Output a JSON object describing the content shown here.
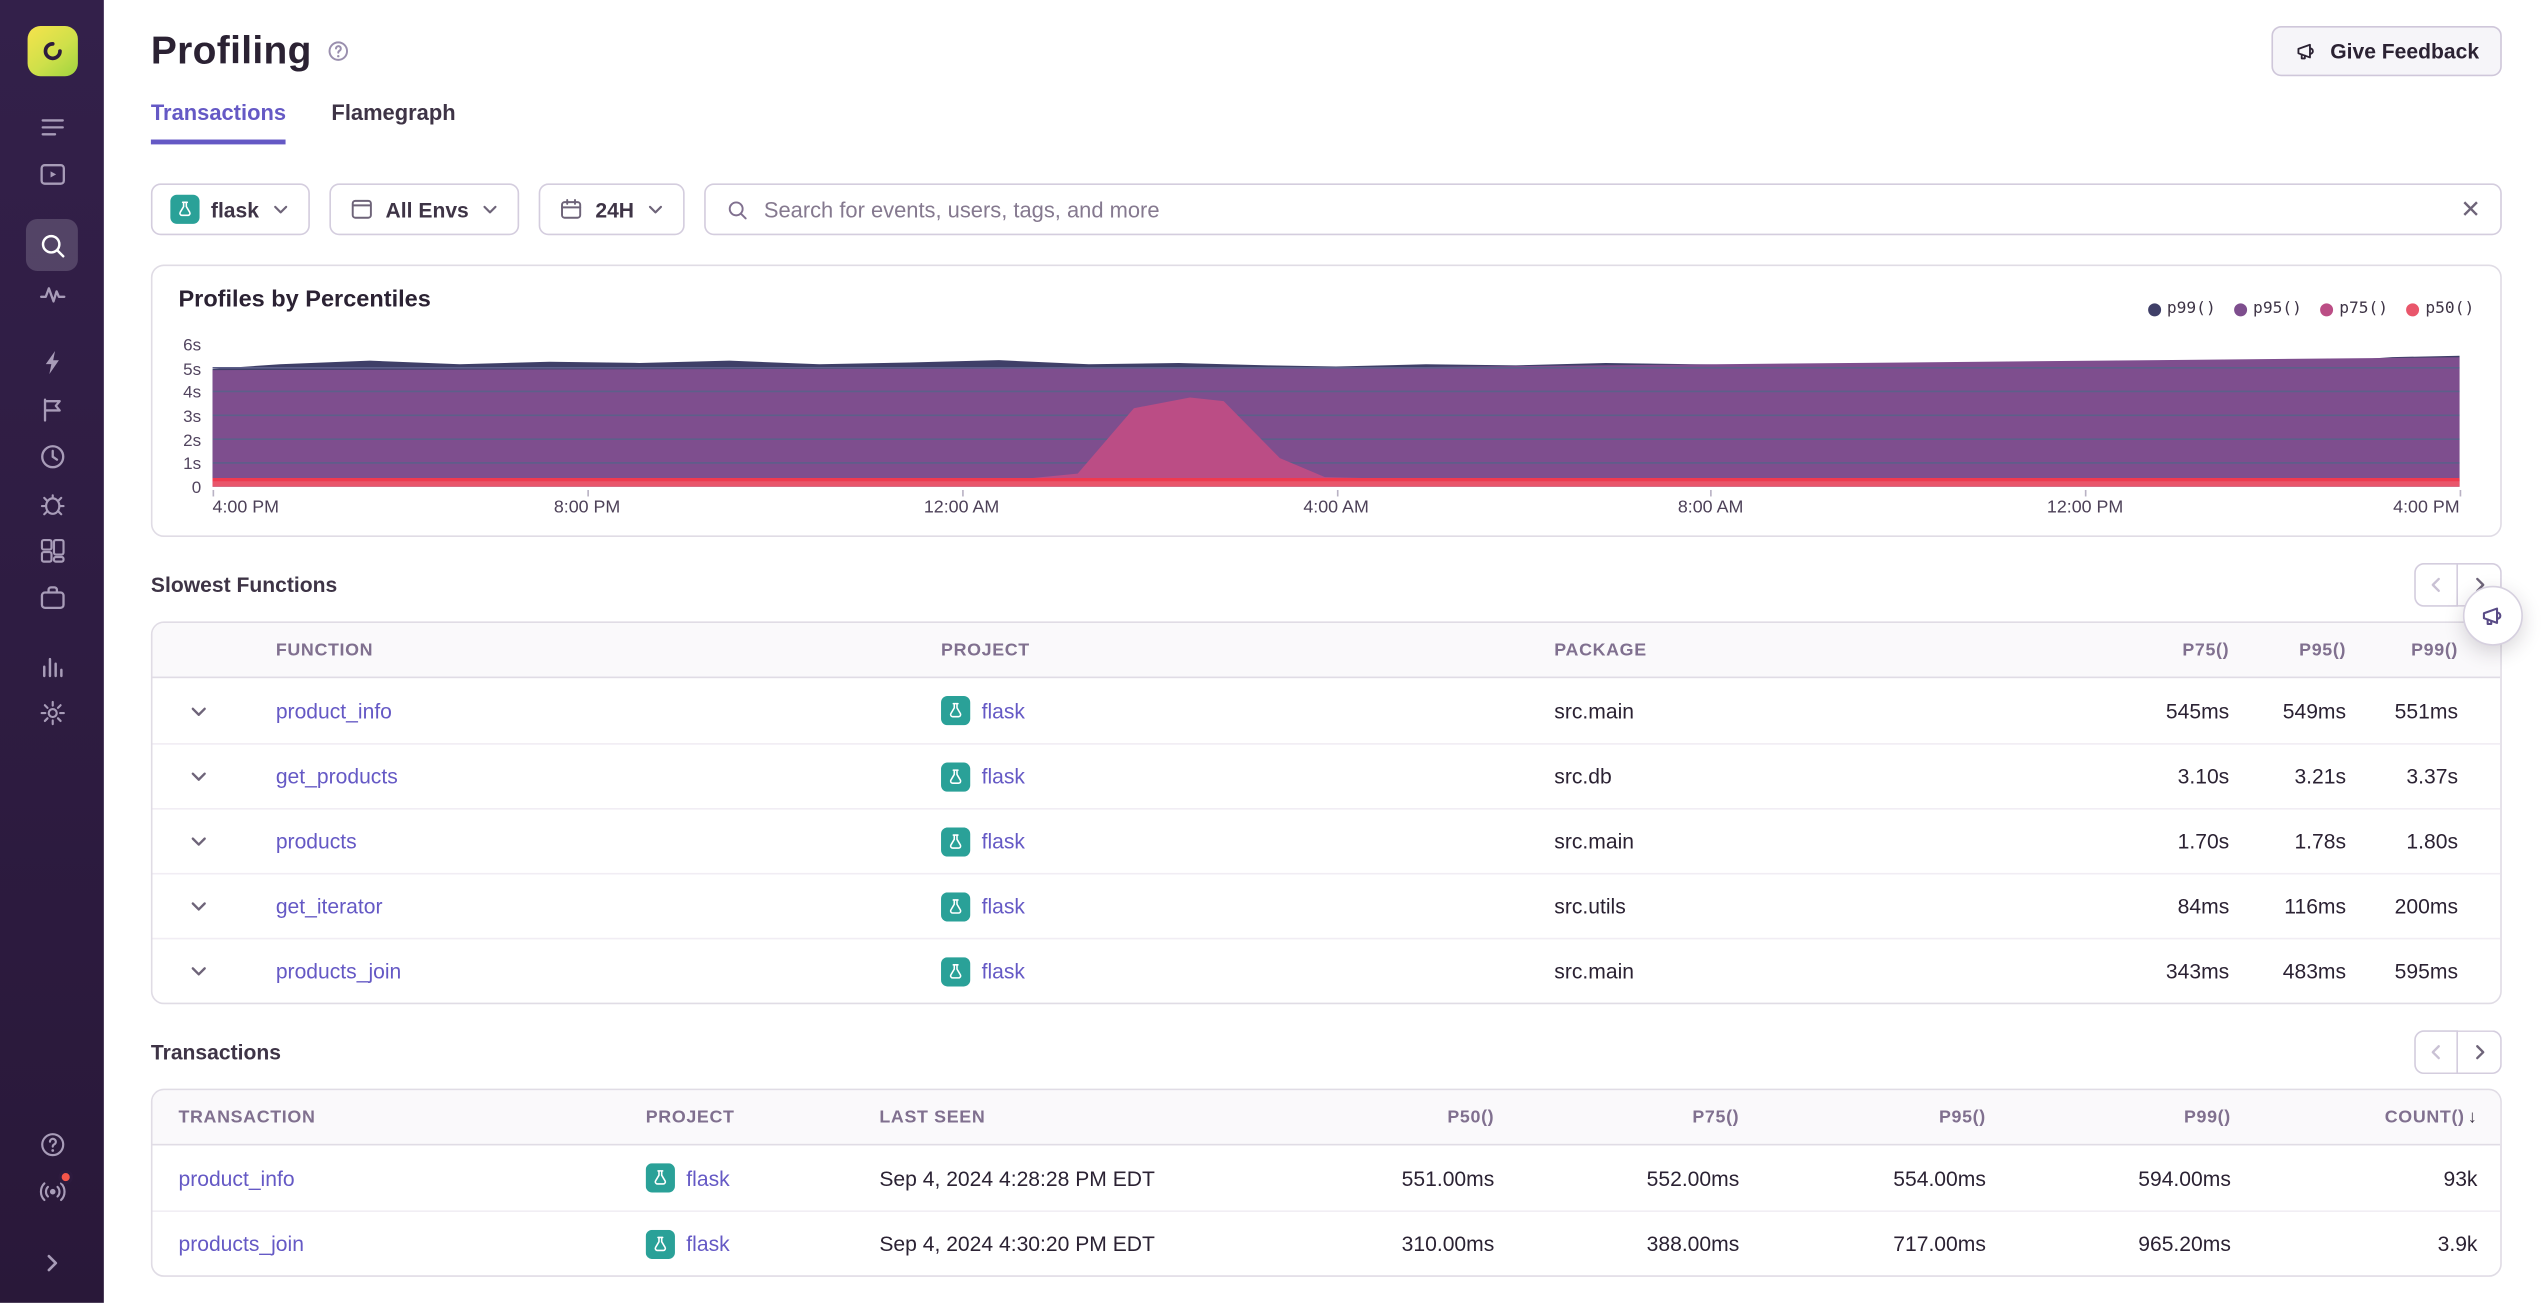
{
  "sidebar": {
    "icons": [
      "sentry-logo",
      "list",
      "play-window",
      "search",
      "pulse",
      "lightning",
      "flag",
      "clock",
      "bug",
      "grid",
      "briefcase",
      "bar-chart",
      "gear"
    ],
    "active_icon": "search",
    "bottom_icons": [
      "help",
      "broadcast",
      "expand"
    ],
    "notification_dot_color": "#f5554a"
  },
  "header": {
    "title": "Profiling",
    "feedback_label": "Give Feedback"
  },
  "tabs": [
    {
      "label": "Transactions",
      "active": true
    },
    {
      "label": "Flamegraph",
      "active": false
    }
  ],
  "filters": {
    "project": "flask",
    "environment": "All Envs",
    "date_range": "24H",
    "search_placeholder": "Search for events, users, tags, and more"
  },
  "chart_data": {
    "type": "area",
    "title": "Profiles by Percentiles",
    "x_ticks": [
      "4:00 PM",
      "8:00 PM",
      "12:00 AM",
      "4:00 AM",
      "8:00 AM",
      "12:00 PM",
      "4:00 PM"
    ],
    "y_ticks": [
      "6s",
      "5s",
      "4s",
      "3s",
      "2s",
      "1s",
      "0"
    ],
    "ylim_seconds": [
      0,
      6
    ],
    "grid": true,
    "gridline_color": "#5d5f8a",
    "legend_position": "top-right",
    "series": [
      {
        "name": "p99()",
        "color": "#3f3f68",
        "points": [
          [
            0,
            4.95
          ],
          [
            0.03,
            5.15
          ],
          [
            0.07,
            5.3
          ],
          [
            0.11,
            5.15
          ],
          [
            0.15,
            5.25
          ],
          [
            0.19,
            5.2
          ],
          [
            0.23,
            5.3
          ],
          [
            0.27,
            5.15
          ],
          [
            0.31,
            5.22
          ],
          [
            0.35,
            5.32
          ],
          [
            0.39,
            5.15
          ],
          [
            0.43,
            5.2
          ],
          [
            0.47,
            5.1
          ],
          [
            0.5,
            5.05
          ],
          [
            0.54,
            5.15
          ],
          [
            0.58,
            5.1
          ],
          [
            0.62,
            5.2
          ],
          [
            0.66,
            5.15
          ],
          [
            0.7,
            5.1
          ],
          [
            0.74,
            5.2
          ],
          [
            0.78,
            5.1
          ],
          [
            0.82,
            5.15
          ],
          [
            0.86,
            5.1
          ],
          [
            0.9,
            5.2
          ],
          [
            0.94,
            5.25
          ],
          [
            0.97,
            5.45
          ],
          [
            1,
            5.5
          ]
        ]
      },
      {
        "name": "p95()",
        "color": "#7e4e8e",
        "points": [
          [
            0,
            4.9
          ],
          [
            0.5,
            5.0
          ],
          [
            1,
            5.44
          ]
        ]
      },
      {
        "name": "p75()",
        "color": "#bb4d85",
        "points": [
          [
            0,
            0.32
          ],
          [
            0.36,
            0.32
          ],
          [
            0.385,
            0.55
          ],
          [
            0.41,
            3.3
          ],
          [
            0.435,
            3.75
          ],
          [
            0.45,
            3.6
          ],
          [
            0.475,
            1.2
          ],
          [
            0.495,
            0.4
          ],
          [
            0.53,
            0.33
          ],
          [
            1,
            0.32
          ]
        ]
      },
      {
        "name": "p50()",
        "color": "#e9566b",
        "line_color": "#ef3a4f",
        "points": [
          [
            0,
            0.3
          ],
          [
            1,
            0.3
          ]
        ]
      }
    ]
  },
  "slowest_functions": {
    "title": "Slowest Functions",
    "columns": [
      "FUNCTION",
      "PROJECT",
      "PACKAGE",
      "P75()",
      "P95()",
      "P99()"
    ],
    "rows": [
      {
        "function": "product_info",
        "project": "flask",
        "package": "src.main",
        "p75": "545ms",
        "p95": "549ms",
        "p99": "551ms"
      },
      {
        "function": "get_products",
        "project": "flask",
        "package": "src.db",
        "p75": "3.10s",
        "p95": "3.21s",
        "p99": "3.37s"
      },
      {
        "function": "products",
        "project": "flask",
        "package": "src.main",
        "p75": "1.70s",
        "p95": "1.78s",
        "p99": "1.80s"
      },
      {
        "function": "get_iterator",
        "project": "flask",
        "package": "src.utils",
        "p75": "84ms",
        "p95": "116ms",
        "p99": "200ms"
      },
      {
        "function": "products_join",
        "project": "flask",
        "package": "src.main",
        "p75": "343ms",
        "p95": "483ms",
        "p99": "595ms"
      }
    ]
  },
  "transactions": {
    "title": "Transactions",
    "columns": [
      "TRANSACTION",
      "PROJECT",
      "LAST SEEN",
      "P50()",
      "P75()",
      "P95()",
      "P99()",
      "COUNT()"
    ],
    "sorted_column": "COUNT()",
    "sort_direction": "desc",
    "rows": [
      {
        "transaction": "product_info",
        "project": "flask",
        "last_seen": "Sep 4, 2024 4:28:28 PM EDT",
        "p50": "551.00ms",
        "p75": "552.00ms",
        "p95": "554.00ms",
        "p99": "594.00ms",
        "count": "93k"
      },
      {
        "transaction": "products_join",
        "project": "flask",
        "last_seen": "Sep 4, 2024 4:30:20 PM EDT",
        "p50": "310.00ms",
        "p75": "388.00ms",
        "p95": "717.00ms",
        "p99": "965.20ms",
        "count": "3.9k"
      }
    ]
  },
  "colors": {
    "accent": "#6559c5",
    "link": "#6559c5",
    "project_icon": "#2aa198",
    "sidebar_bg": "#2d1b3e"
  }
}
